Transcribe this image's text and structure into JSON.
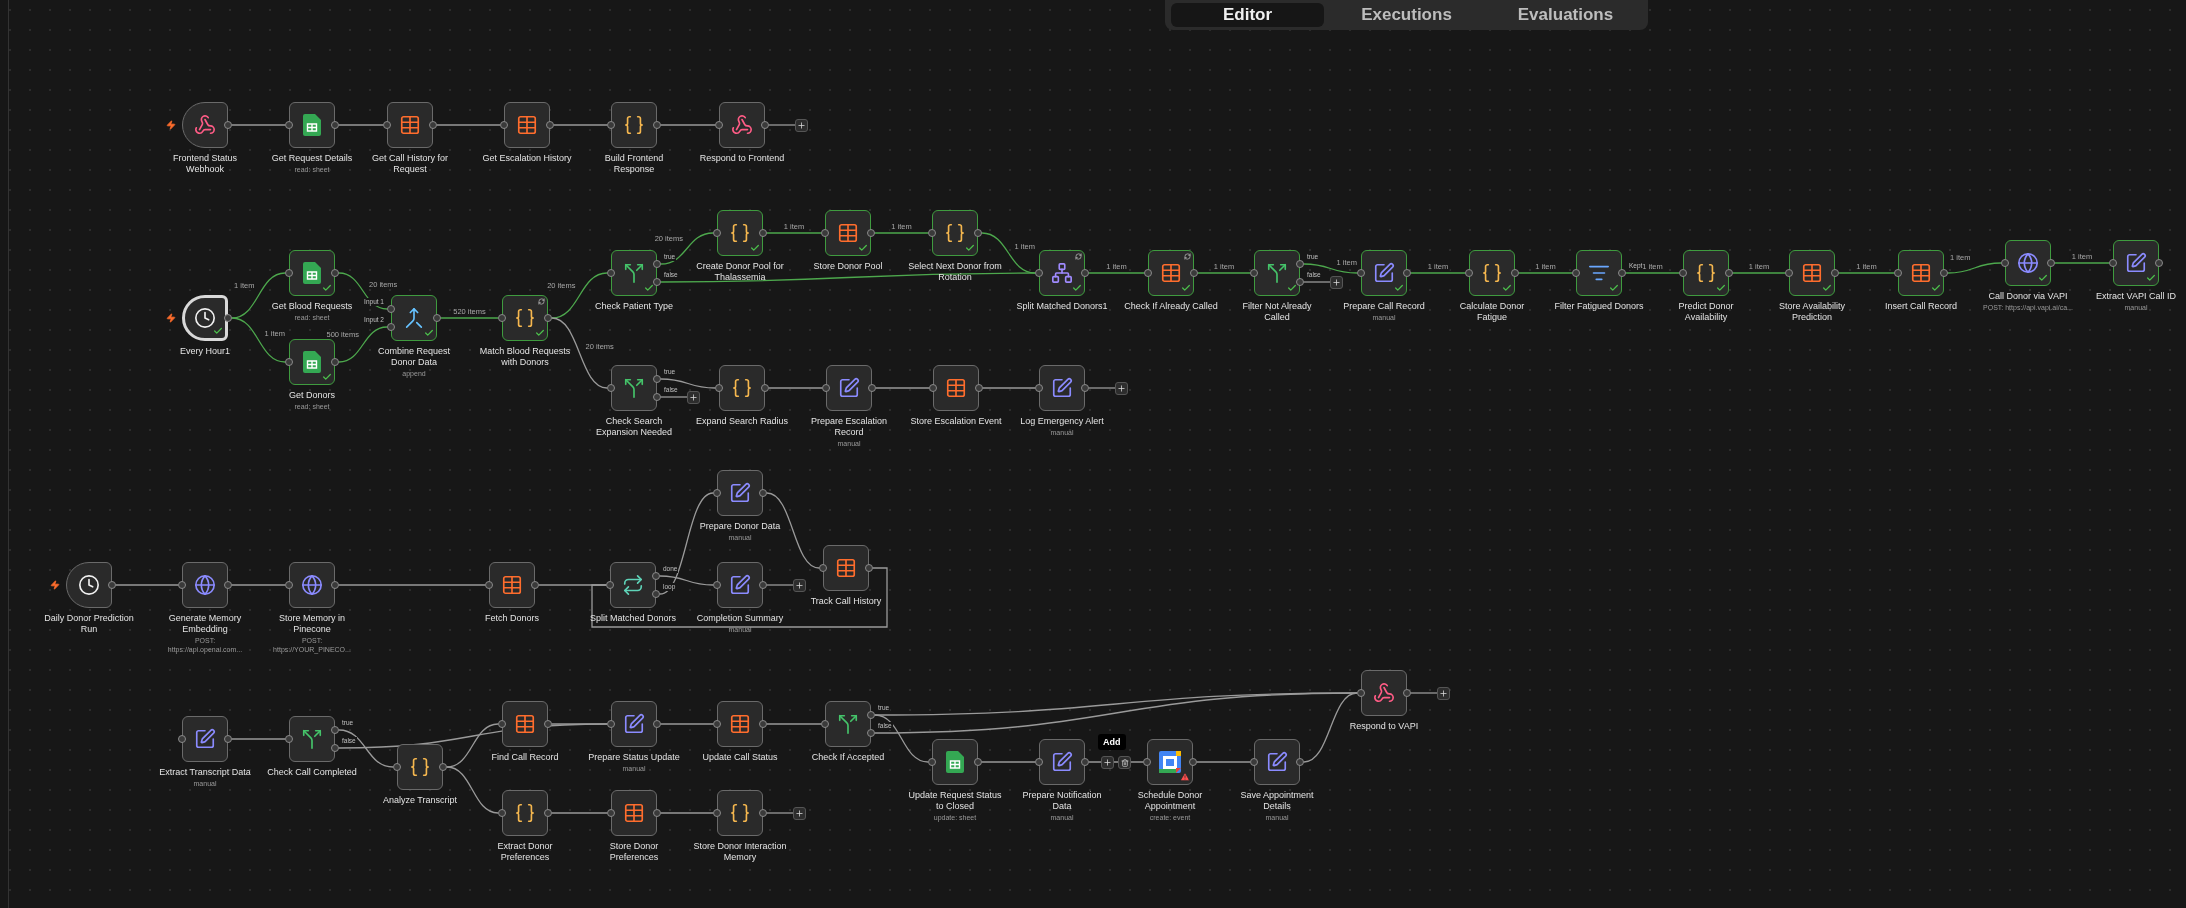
{
  "tabs": [
    {
      "label": "Editor",
      "selected": true
    },
    {
      "label": "Executions",
      "selected": false
    },
    {
      "label": "Evaluations",
      "selected": false
    }
  ],
  "nodes": [
    {
      "label": "Frontend Status Webhook",
      "kind": "webhook",
      "trigger": true,
      "success": false,
      "selected": false,
      "warning": false,
      "pinned": false
    },
    {
      "label": "Get Request Details",
      "sub": "read: sheet",
      "kind": "sheets",
      "trigger": false,
      "success": false,
      "selected": false,
      "warning": false,
      "pinned": false
    },
    {
      "label": "Get Call History for Request",
      "kind": "table",
      "trigger": false,
      "success": false,
      "selected": false,
      "warning": false,
      "pinned": false
    },
    {
      "label": "Get Escalation History",
      "kind": "table",
      "trigger": false,
      "success": false,
      "selected": false,
      "warning": false,
      "pinned": false
    },
    {
      "label": "Build Frontend Response",
      "kind": "code",
      "trigger": false,
      "success": false,
      "selected": false,
      "warning": false,
      "pinned": false
    },
    {
      "label": "Respond to Frontend",
      "kind": "webhook",
      "trigger": false,
      "success": false,
      "selected": false,
      "warning": false,
      "pinned": false
    },
    {
      "label": "Every Hour1",
      "kind": "schedule",
      "trigger": true,
      "success": true,
      "selected": true,
      "warning": false,
      "pinned": false
    },
    {
      "label": "Get Blood Requests",
      "sub": "read: sheet",
      "kind": "sheets",
      "trigger": false,
      "success": true,
      "selected": false,
      "warning": false,
      "pinned": false
    },
    {
      "label": "Get Donors",
      "sub": "read: sheet",
      "kind": "sheets",
      "trigger": false,
      "success": true,
      "selected": false,
      "warning": false,
      "pinned": false
    },
    {
      "label": "Combine Request Donor Data",
      "sub": "append",
      "kind": "merge",
      "trigger": false,
      "success": true,
      "selected": false,
      "warning": false,
      "pinned": false,
      "inputs": [
        "Input 1",
        "Input 2"
      ]
    },
    {
      "label": "Match Blood Requests with Donors",
      "kind": "code",
      "trigger": false,
      "success": true,
      "selected": false,
      "warning": false,
      "pinned": true
    },
    {
      "label": "Check Patient Type",
      "kind": "if",
      "trigger": false,
      "success": true,
      "selected": false,
      "warning": false,
      "pinned": false,
      "outputs": [
        "true",
        "false"
      ]
    },
    {
      "label": "Create Donor Pool for Thalassemia",
      "kind": "code",
      "trigger": false,
      "success": true,
      "selected": false,
      "warning": false,
      "pinned": false
    },
    {
      "label": "Store Donor Pool",
      "kind": "table",
      "trigger": false,
      "success": true,
      "selected": false,
      "warning": false,
      "pinned": false
    },
    {
      "label": "Select Next Donor from Rotation",
      "kind": "code",
      "trigger": false,
      "success": true,
      "selected": false,
      "warning": false,
      "pinned": false
    },
    {
      "label": "Split Matched Donors1",
      "kind": "split",
      "trigger": false,
      "success": true,
      "selected": false,
      "warning": false,
      "pinned": true
    },
    {
      "label": "Check If Already Called",
      "kind": "table",
      "trigger": false,
      "success": true,
      "selected": false,
      "warning": false,
      "pinned": true
    },
    {
      "label": "Filter Not Already Called",
      "kind": "if",
      "trigger": false,
      "success": true,
      "selected": false,
      "warning": false,
      "pinned": false,
      "outputs": [
        "true",
        "false"
      ]
    },
    {
      "label": "Prepare Call Record",
      "sub": "manual",
      "kind": "edit",
      "trigger": false,
      "success": true,
      "selected": false,
      "warning": false,
      "pinned": false
    },
    {
      "label": "Calculate Donor Fatigue",
      "kind": "code",
      "trigger": false,
      "success": true,
      "selected": false,
      "warning": false,
      "pinned": false
    },
    {
      "label": "Filter Fatigued Donors",
      "kind": "filter",
      "trigger": false,
      "success": true,
      "selected": false,
      "warning": false,
      "pinned": false,
      "outputs": [
        "Kept"
      ]
    },
    {
      "label": "Predict Donor Availability",
      "kind": "code",
      "trigger": false,
      "success": true,
      "selected": false,
      "warning": false,
      "pinned": false
    },
    {
      "label": "Store Availability Prediction",
      "kind": "table",
      "trigger": false,
      "success": true,
      "selected": false,
      "warning": false,
      "pinned": false
    },
    {
      "label": "Insert Call Record",
      "kind": "table",
      "trigger": false,
      "success": true,
      "selected": false,
      "warning": false,
      "pinned": false
    },
    {
      "label": "Call Donor via VAPI",
      "sub": "POST: https://api.vapi.ai/ca...",
      "kind": "http",
      "trigger": false,
      "success": true,
      "selected": false,
      "warning": false,
      "pinned": false
    },
    {
      "label": "Extract VAPI Call ID",
      "sub": "manual",
      "kind": "edit",
      "trigger": false,
      "success": true,
      "selected": false,
      "warning": false,
      "pinned": false
    },
    {
      "label": "Check Search Expansion Needed",
      "kind": "if",
      "trigger": false,
      "success": false,
      "selected": false,
      "warning": false,
      "pinned": false,
      "outputs": [
        "true",
        "false"
      ]
    },
    {
      "label": "Expand Search Radius",
      "kind": "code",
      "trigger": false,
      "success": false,
      "selected": false,
      "warning": false,
      "pinned": false
    },
    {
      "label": "Prepare Escalation Record",
      "sub": "manual",
      "kind": "edit",
      "trigger": false,
      "success": false,
      "selected": false,
      "warning": false,
      "pinned": false
    },
    {
      "label": "Store Escalation Event",
      "kind": "table",
      "trigger": false,
      "success": false,
      "selected": false,
      "warning": false,
      "pinned": false
    },
    {
      "label": "Log Emergency Alert",
      "sub": "manual",
      "kind": "edit",
      "trigger": false,
      "success": false,
      "selected": false,
      "warning": false,
      "pinned": false
    },
    {
      "label": "Daily Donor Prediction Run",
      "kind": "schedule",
      "trigger": true,
      "success": false,
      "selected": false,
      "warning": false,
      "pinned": false
    },
    {
      "label": "Generate Memory Embedding",
      "sub": "POST: https://api.openai.com...",
      "kind": "http",
      "trigger": false,
      "success": false,
      "selected": false,
      "warning": false,
      "pinned": false
    },
    {
      "label": "Store Memory in Pinecone",
      "sub": "POST: https://YOUR_PINECO...",
      "kind": "http",
      "trigger": false,
      "success": false,
      "selected": false,
      "warning": false,
      "pinned": false
    },
    {
      "label": "Fetch Donors",
      "kind": "table",
      "trigger": false,
      "success": false,
      "selected": false,
      "warning": false,
      "pinned": false
    },
    {
      "label": "Split Matched Donors",
      "kind": "loop",
      "trigger": false,
      "success": false,
      "selected": false,
      "warning": false,
      "pinned": false,
      "outputs": [
        "done",
        "loop"
      ]
    },
    {
      "label": "Prepare Donor Data",
      "sub": "manual",
      "kind": "edit",
      "trigger": false,
      "success": false,
      "selected": false,
      "warning": false,
      "pinned": false
    },
    {
      "label": "Completion Summary",
      "sub": "manual",
      "kind": "edit",
      "trigger": false,
      "success": false,
      "selected": false,
      "warning": false,
      "pinned": false
    },
    {
      "label": "Track Call History",
      "kind": "table",
      "trigger": false,
      "success": false,
      "selected": false,
      "warning": false,
      "pinned": false
    },
    {
      "label": "Extract Transcript Data",
      "sub": "manual",
      "kind": "edit",
      "trigger": false,
      "success": false,
      "selected": false,
      "warning": false,
      "pinned": false
    },
    {
      "label": "Check Call Completed",
      "kind": "if",
      "trigger": false,
      "success": false,
      "selected": false,
      "warning": false,
      "pinned": false,
      "outputs": [
        "true",
        "false"
      ]
    },
    {
      "label": "Analyze Transcript",
      "kind": "code",
      "trigger": false,
      "success": false,
      "selected": false,
      "warning": false,
      "pinned": false
    },
    {
      "label": "Find Call Record",
      "kind": "table",
      "trigger": false,
      "success": false,
      "selected": false,
      "warning": false,
      "pinned": false
    },
    {
      "label": "Prepare Status Update",
      "sub": "manual",
      "kind": "edit",
      "trigger": false,
      "success": false,
      "selected": false,
      "warning": false,
      "pinned": false
    },
    {
      "label": "Update Call Status",
      "kind": "table",
      "trigger": false,
      "success": false,
      "selected": false,
      "warning": false,
      "pinned": false
    },
    {
      "label": "Check If Accepted",
      "kind": "if",
      "trigger": false,
      "success": false,
      "selected": false,
      "warning": false,
      "pinned": false,
      "outputs": [
        "true",
        "false"
      ]
    },
    {
      "label": "Extract Donor Preferences",
      "kind": "code",
      "trigger": false,
      "success": false,
      "selected": false,
      "warning": false,
      "pinned": false
    },
    {
      "label": "Store Donor Preferences",
      "kind": "table",
      "trigger": false,
      "success": false,
      "selected": false,
      "warning": false,
      "pinned": false
    },
    {
      "label": "Store Donor Interaction Memory",
      "kind": "code",
      "trigger": false,
      "success": false,
      "selected": false,
      "warning": false,
      "pinned": false
    },
    {
      "label": "Update Request Status to Closed",
      "sub": "update: sheet",
      "kind": "sheets",
      "trigger": false,
      "success": false,
      "selected": false,
      "warning": false,
      "pinned": false
    },
    {
      "label": "Prepare Notification Data",
      "sub": "manual",
      "kind": "edit",
      "trigger": false,
      "success": false,
      "selected": false,
      "warning": false,
      "pinned": false
    },
    {
      "label": "Schedule Donor Appointment",
      "sub": "create: event",
      "kind": "calendar",
      "trigger": false,
      "success": false,
      "selected": false,
      "warning": true,
      "pinned": false
    },
    {
      "label": "Save Appointment Details",
      "sub": "manual",
      "kind": "edit",
      "trigger": false,
      "success": false,
      "selected": false,
      "warning": false,
      "pinned": false
    },
    {
      "label": "Respond to VAPI",
      "kind": "webhook",
      "trigger": false,
      "success": false,
      "selected": false,
      "warning": false,
      "pinned": false
    }
  ],
  "edge_labels": [
    "1 item",
    "1 item",
    "20 items",
    "500 items",
    "520 items",
    "20 items",
    "20 items",
    "20 items",
    "1 item",
    "1 item",
    "1 item",
    "1 item",
    "1 item",
    "1 item",
    "1 item",
    "1 item",
    "1 item",
    "1 item",
    "1 item",
    "1 item",
    "1 item"
  ],
  "edge_toolbar": {
    "tooltip": "Add"
  }
}
